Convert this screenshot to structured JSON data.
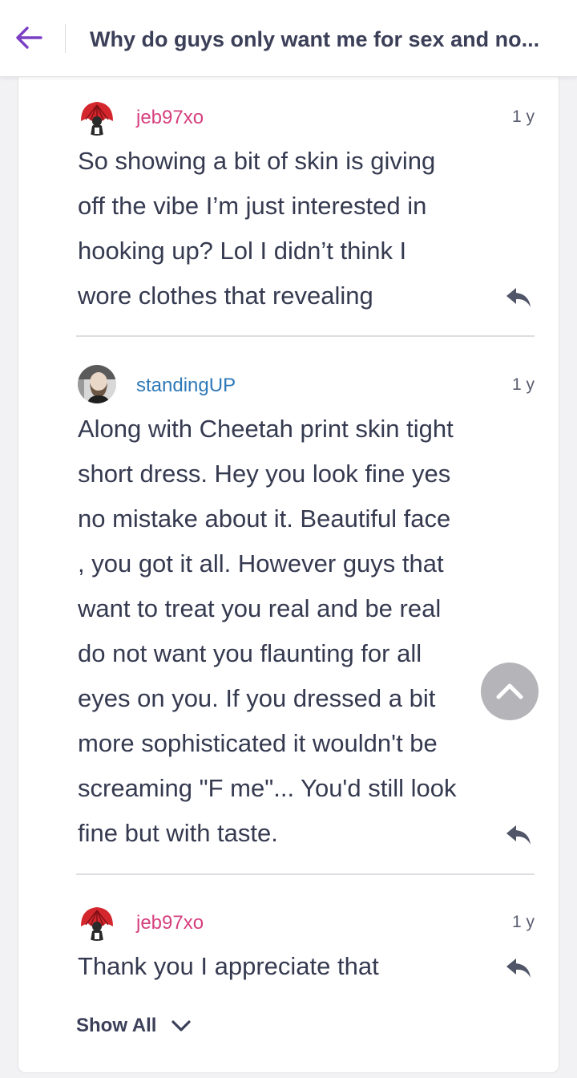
{
  "header": {
    "title": "Why do guys only want me for sex and no...",
    "accent_color": "#7b3fc4"
  },
  "comments": [
    {
      "username": "jeb97xo",
      "username_color": "#d6407e",
      "avatar_icon": "red-fan-avatar-icon",
      "time": "1 y",
      "lines": [
        "So showing a bit of skin is giving",
        "off the vibe I’m just interested in",
        "hooking up? Lol I didn’t think I",
        "wore clothes that revealing"
      ]
    },
    {
      "username": "standingUP",
      "username_color": "#2f79b8",
      "avatar_icon": "bearded-man-photo-avatar-icon",
      "time": "1 y",
      "lines": [
        "Along with Cheetah print skin tight",
        "short dress. Hey you look fine yes",
        "no mistake about it. Beautiful face",
        ", you got it all. However guys that",
        "want to treat you real and be real",
        "do not want you flaunting for all",
        "eyes on you. If you dressed a bit",
        "more sophisticated it wouldn't be",
        "screaming \"F me\"... You'd still look",
        "fine but with taste."
      ]
    },
    {
      "username": "jeb97xo",
      "username_color": "#d6407e",
      "avatar_icon": "red-fan-avatar-icon",
      "time": "1 y",
      "lines": [
        "Thank you I appreciate that"
      ]
    }
  ],
  "footer": {
    "show_all_label": "Show All"
  }
}
